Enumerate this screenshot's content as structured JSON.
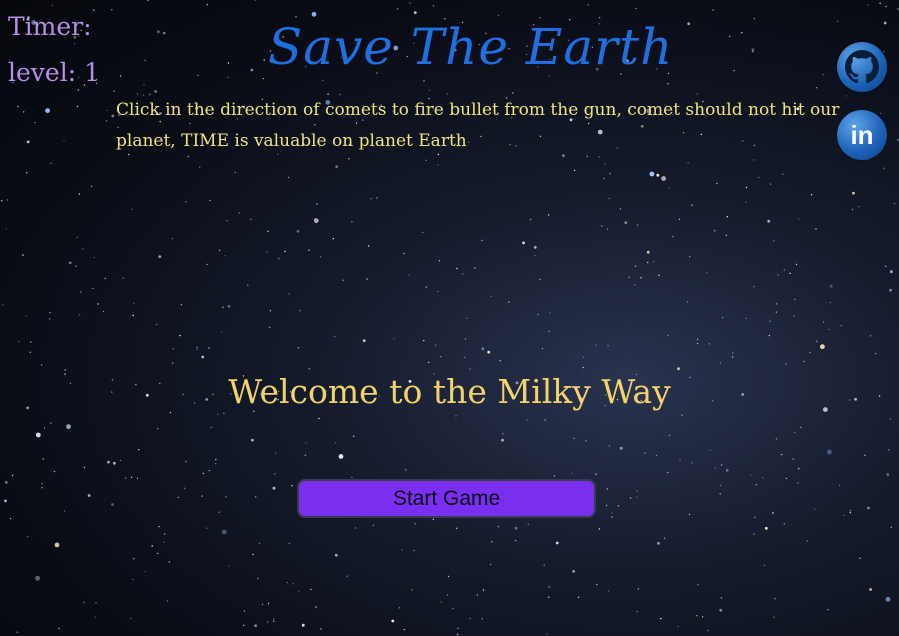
{
  "hud": {
    "timer_label": "Timer:",
    "level_label": "level: 1"
  },
  "header": {
    "title": "Save The Earth",
    "instructions": "Click in the direction of comets to fire bullet from the gun, comet should not hit our planet, TIME is valuable on planet Earth"
  },
  "social": [
    {
      "icon": "github-icon"
    },
    {
      "icon": "linkedin-icon",
      "glyph": "in"
    }
  ],
  "main": {
    "welcome": "Welcome to the Milky Way",
    "start_button_label": "Start Game"
  },
  "colors": {
    "title": "#1f6fe0",
    "hud_text": "#b88ee8",
    "instructions_text": "#f2e27e",
    "welcome_text": "#f2d36a",
    "button_bg": "#7a2ff0"
  }
}
